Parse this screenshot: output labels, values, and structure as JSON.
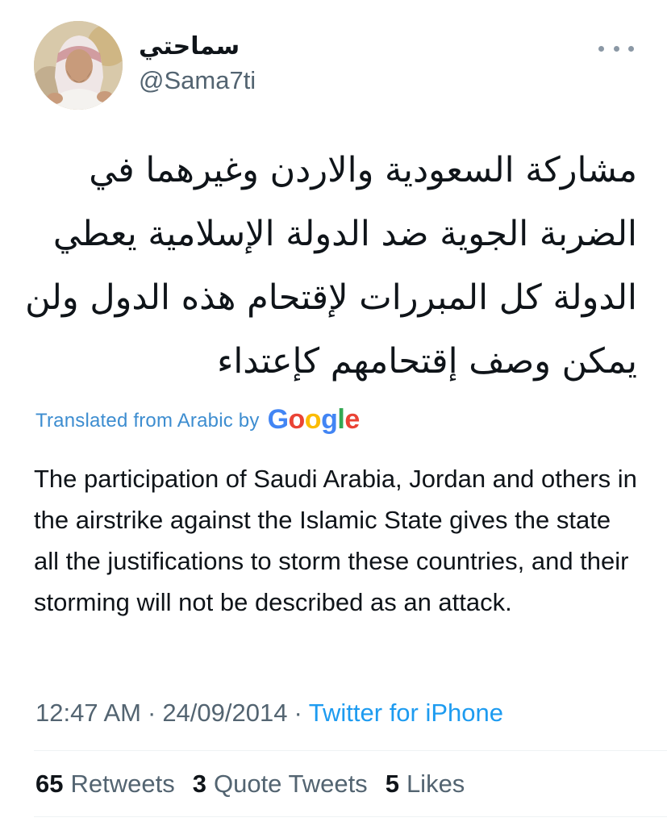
{
  "author": {
    "display_name": "سماحتي",
    "handle": "@Sama7ti"
  },
  "tweet": {
    "arabic_text": "مشاركة السعودية والاردن وغيرهما في\nالضربة الجوية ضد الدولة الإسلامية يعطي\nالدولة كل المبررات لإقتحام هذه الدول ولن\nيمكن وصف إقتحامهم كإعتداء",
    "translated_label": "Translated from Arabic by",
    "google_letters": [
      "G",
      "o",
      "o",
      "g",
      "l",
      "e"
    ],
    "google_colors": [
      "#4285f4",
      "#ea4335",
      "#fbbc05",
      "#4285f4",
      "#34a853",
      "#ea4335"
    ],
    "translation": "The participation of Saudi Arabia, Jordan and others in the airstrike against the Islamic State gives the state all the justifications to storm these countries, and their storming will not be described as an attack.",
    "time": "12:47 AM",
    "date": "24/09/2014",
    "separator": "·",
    "source": "Twitter for iPhone"
  },
  "stats": {
    "retweets_count": "65",
    "retweets_label": "Retweets",
    "quotes_count": "3",
    "quotes_label": "Quote Tweets",
    "likes_count": "5",
    "likes_label": "Likes"
  },
  "colors": {
    "link": "#1d9bf0",
    "translated_label": "#3d8dd0",
    "secondary_text": "#536471",
    "primary_text": "#0f1419"
  }
}
